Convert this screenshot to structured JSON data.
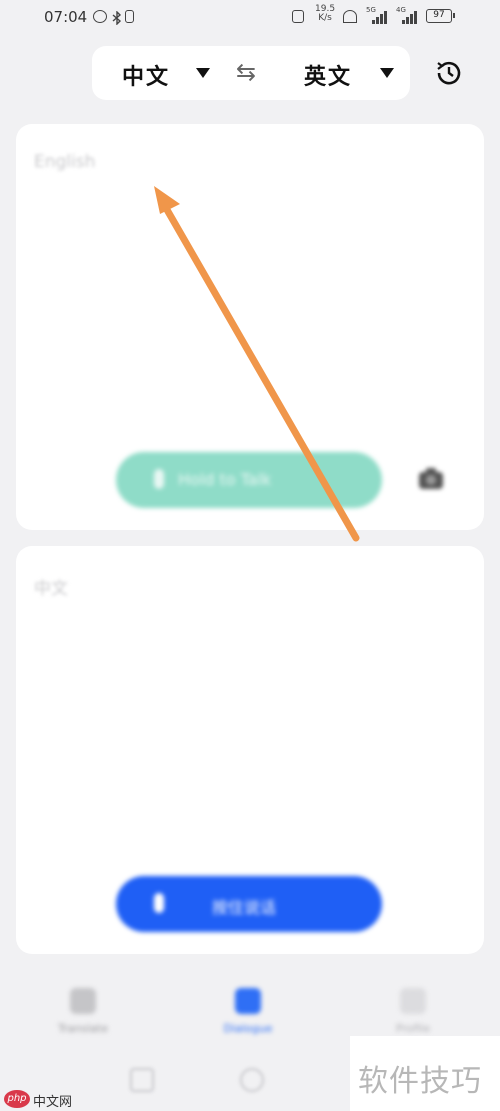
{
  "status_bar": {
    "time": "07:04",
    "net_speed_value": "19.5",
    "net_speed_unit": "K/s",
    "signal_1_tag": "5G",
    "signal_2_tag": "4G",
    "battery": "97"
  },
  "language_bar": {
    "source_language": "中文",
    "target_language": "英文",
    "swap_symbol": "⇆"
  },
  "input_card": {
    "placeholder": "English",
    "voice_button_label": "Hold to Talk"
  },
  "output_card": {
    "placeholder": "中文",
    "voice_button_label": "按住说话"
  },
  "bottom_nav": {
    "items": [
      {
        "label": "Translate"
      },
      {
        "label": "Dialogue"
      },
      {
        "label": "Profile"
      }
    ]
  },
  "watermark": {
    "right_text": "软件技巧",
    "left_logo": "php",
    "left_text": "中文网"
  },
  "colors": {
    "accent_blue": "#1f5ff5",
    "accent_green": "#8fdcc8",
    "arrow_orange": "#f0964a"
  },
  "icons": [
    "alarm-icon",
    "bluetooth-icon",
    "vibrate-icon",
    "hotspot-icon",
    "history-icon",
    "swap-icon",
    "mic-icon",
    "camera-icon"
  ]
}
